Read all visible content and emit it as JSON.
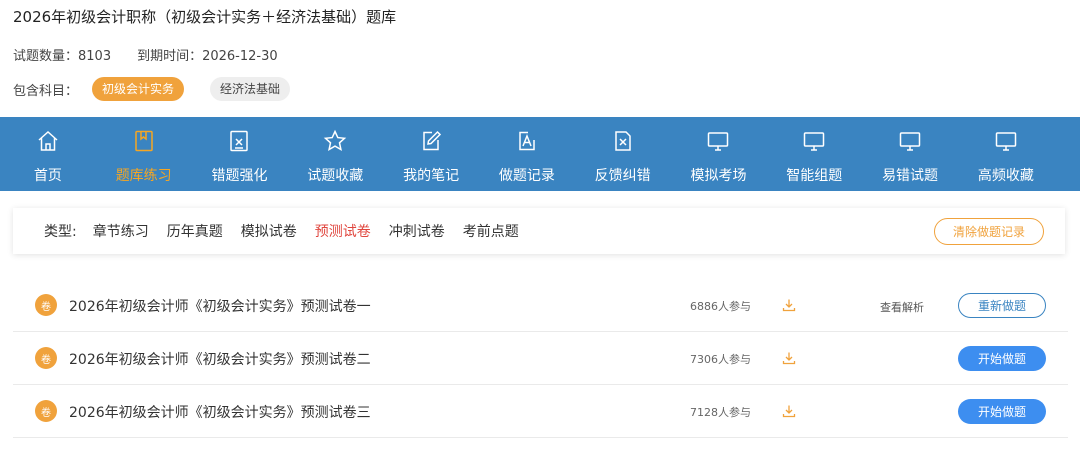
{
  "page": {
    "title": "2026年初级会计职称（初级会计实务＋经济法基础）题库",
    "question_count": "试题数量：8103",
    "expiry": "到期时间：2026-12-30",
    "subjects_label": "包含科目：",
    "subjects": [
      "初级会计实务",
      "经济法基础"
    ]
  },
  "nav": {
    "items": [
      {
        "label": "首页",
        "icon": "home-icon"
      },
      {
        "label": "题库练习",
        "icon": "book-icon"
      },
      {
        "label": "错题强化",
        "icon": "wrong-question-icon"
      },
      {
        "label": "试题收藏",
        "icon": "star-icon"
      },
      {
        "label": "我的笔记",
        "icon": "edit-note-icon"
      },
      {
        "label": "做题记录",
        "icon": "record-icon"
      },
      {
        "label": "反馈纠错",
        "icon": "feedback-icon"
      },
      {
        "label": "模拟考场",
        "icon": "monitor-icon"
      },
      {
        "label": "智能组题",
        "icon": "monitor-icon"
      },
      {
        "label": "易错试题",
        "icon": "monitor-icon"
      },
      {
        "label": "高频收藏",
        "icon": "monitor-icon"
      }
    ],
    "active_color": "#f5a623",
    "bar_color": "#3a84c1"
  },
  "filter": {
    "label": "类型:",
    "items": [
      "章节练习",
      "历年真题",
      "模拟试卷",
      "预测试卷",
      "冲刺试卷",
      "考前点题"
    ],
    "active": "预测试卷",
    "clear_label": "清除做题记录"
  },
  "papers": [
    {
      "badge": "卷",
      "title": "2026年初级会计师《初级会计实务》预测试卷一",
      "participants": "6886人参与",
      "view_label": "查看解析",
      "action": "重新做题"
    },
    {
      "badge": "卷",
      "title": "2026年初级会计师《初级会计实务》预测试卷二",
      "participants": "7306人参与",
      "view_label": "",
      "action": "开始做题"
    },
    {
      "badge": "卷",
      "title": "2026年初级会计师《初级会计实务》预测试卷三",
      "participants": "7128人参与",
      "view_label": "",
      "action": "开始做题"
    }
  ]
}
